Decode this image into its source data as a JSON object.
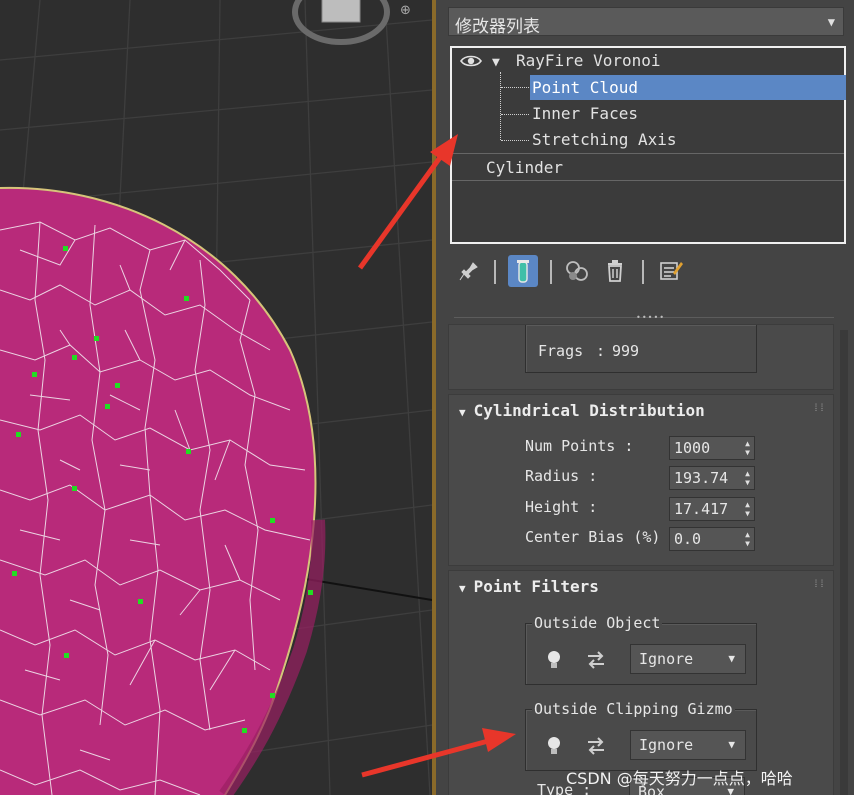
{
  "panel": {
    "modifier_list_label": "修改器列表",
    "stack": {
      "items": [
        {
          "label": "RayFire Voronoi",
          "level": 0,
          "expanded": true
        },
        {
          "label": "Point Cloud",
          "level": 1,
          "selected": true
        },
        {
          "label": "Inner Faces",
          "level": 1
        },
        {
          "label": "Stretching Axis",
          "level": 1
        },
        {
          "label": "Cylinder",
          "level": 0
        }
      ]
    },
    "toolbar_icons": [
      "pin-stack-icon",
      "show-end-result-icon",
      "make-unique-icon",
      "remove-modifier-icon",
      "configure-modifier-sets-icon"
    ]
  },
  "frags": {
    "label": "Frags",
    "value": "999"
  },
  "cylindrical_distribution": {
    "title": "Cylindrical Distribution",
    "fields": [
      {
        "label": "Num Points :",
        "value": "1000"
      },
      {
        "label": "Radius :",
        "value": "193.74"
      },
      {
        "label": "Height :",
        "value": "17.417"
      },
      {
        "label": "Center Bias (%)",
        "value": "0.0"
      }
    ]
  },
  "point_filters": {
    "title": "Point Filters",
    "outside_object": {
      "label": "Outside Object",
      "option": "Ignore"
    },
    "outside_clipping_gizmo": {
      "label": "Outside Clipping Gizmo",
      "option": "Ignore"
    },
    "type": {
      "label": "Type :",
      "option": "Box"
    }
  },
  "watermark": "CSDN @每天努力一点点，哈哈",
  "colors": {
    "selection_blue": "#5b87c5",
    "object_magenta": "#b82a7a",
    "point_green": "#22dd22",
    "arrow_red": "#e8362a"
  }
}
